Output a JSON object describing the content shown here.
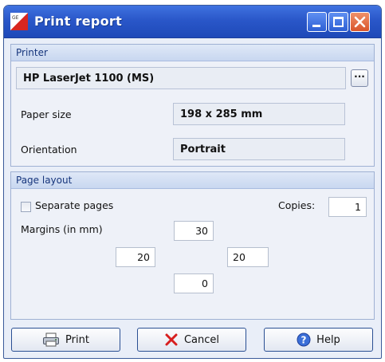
{
  "window": {
    "title": "Print report"
  },
  "printer_group": {
    "header": "Printer",
    "printer_name": "HP LaserJet 1100 (MS)",
    "browse_label": "···",
    "paper_size_label": "Paper size",
    "paper_size_value": "198 x 285 mm",
    "orientation_label": "Orientation",
    "orientation_value": "Portrait"
  },
  "layout_group": {
    "header": "Page layout",
    "separate_pages_label": "Separate pages",
    "separate_pages_checked": false,
    "copies_label": "Copies:",
    "copies_value": "1",
    "margins_label": "Margins (in mm)",
    "margin_top": "30",
    "margin_left": "20",
    "margin_right": "20",
    "margin_bottom": "0"
  },
  "buttons": {
    "print": "Print",
    "cancel": "Cancel",
    "help": "Help"
  },
  "icons": {
    "app": "app-logo-icon",
    "minimize": "minimize-icon",
    "maximize": "maximize-icon",
    "close": "close-icon",
    "print": "printer-icon",
    "cancel": "red-x-icon",
    "help": "help-icon"
  },
  "colors": {
    "titlebar": "#2a57c9",
    "close_button": "#d9542a",
    "group_header_text": "#16357c"
  }
}
